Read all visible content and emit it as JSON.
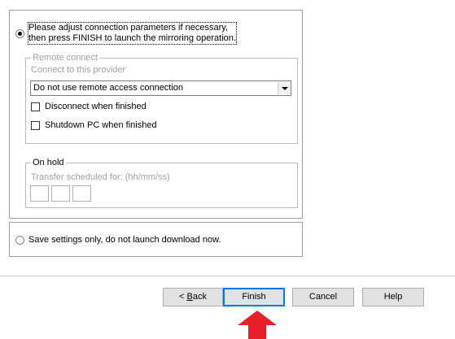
{
  "launch_option": {
    "line1": "Please adjust connection parameters if necessary,",
    "line2": "then press FINISH to launch the mirroring operation."
  },
  "remote_connect": {
    "legend": "Remote connect",
    "provider_label": "Connect to this provider",
    "provider_value": "Do not use remote access connection",
    "disconnect_label": "Disconnect when finished",
    "shutdown_label": "Shutdown PC when finished"
  },
  "on_hold": {
    "legend": "On hold",
    "scheduled_label": "Transfer scheduled for: (hh/mm/ss)"
  },
  "save_option": {
    "label": "Save settings only, do not launch download now."
  },
  "buttons": {
    "back_prefix": "< ",
    "back_mnemonic": "B",
    "back_rest": "ack",
    "finish": "Finish",
    "cancel": "Cancel",
    "help": "Help"
  },
  "colors": {
    "arrow": "#e8202a",
    "default_button_border": "#0078d7"
  }
}
